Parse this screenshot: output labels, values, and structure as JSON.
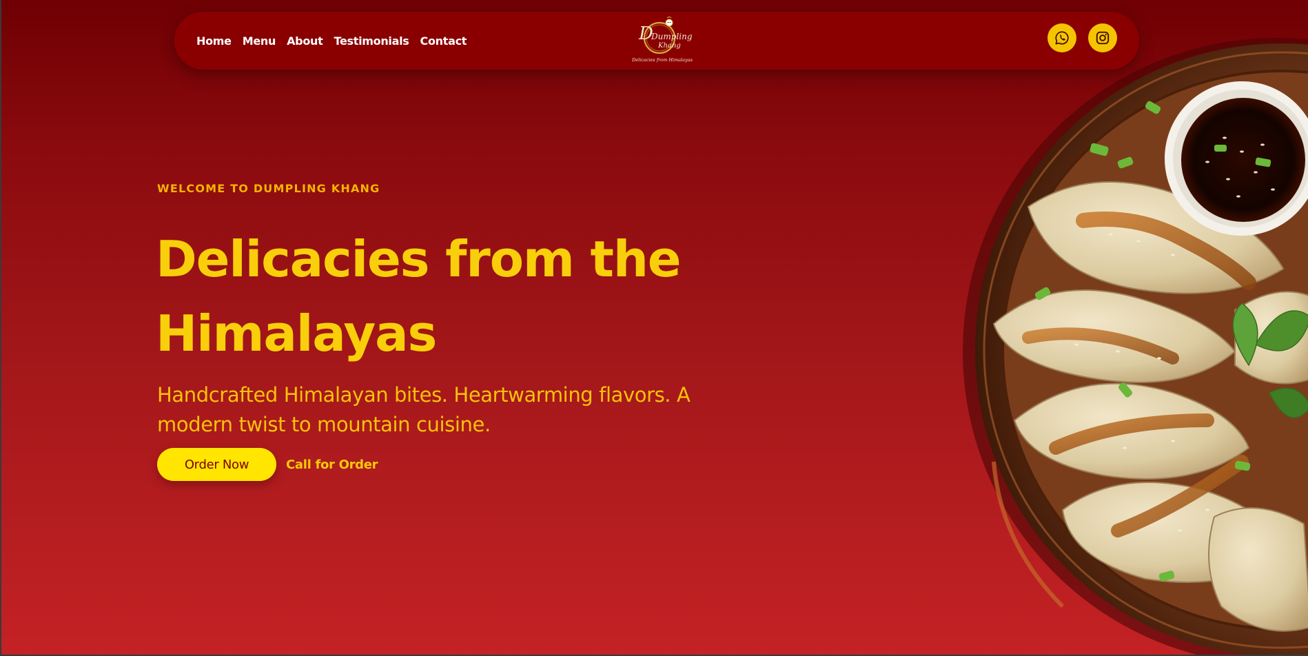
{
  "nav": {
    "links": [
      "Home",
      "Menu",
      "About",
      "Testimonials",
      "Contact"
    ],
    "logo": {
      "name_line1": "Dumpling",
      "name_line2": "Khang",
      "tagline": "Delicacies from Himalayas"
    },
    "socials": [
      {
        "icon": "whatsapp-icon"
      },
      {
        "icon": "instagram-icon"
      }
    ]
  },
  "hero": {
    "eyebrow": "WELCOME TO DUMPLING KHANG",
    "headline": "Delicacies from the Himalayas",
    "subtext": "Handcrafted Himalayan bites. Heartwarming flavors. A modern twist to mountain cuisine.",
    "order_button": "Order Now",
    "call_link": "Call for Order"
  },
  "colors": {
    "background_top": "#6f0003",
    "background_bottom": "#c42224",
    "navbar": "#8a0000",
    "accent_yellow": "#f8cf0a",
    "button_yellow": "#ffe500",
    "social_yellow": "#f5c400"
  },
  "image": {
    "icon": "dumpling-plate-image"
  }
}
